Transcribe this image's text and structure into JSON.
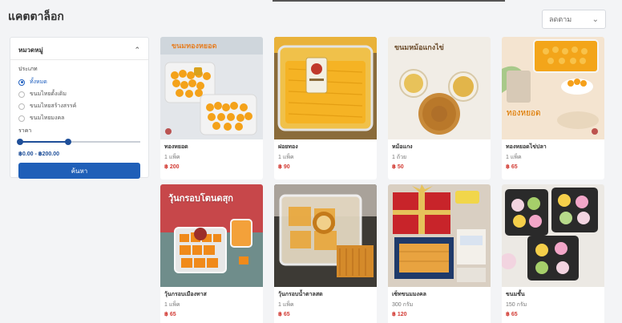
{
  "page": {
    "title": "แคตตาล็อก"
  },
  "sort": {
    "label": "ลดตาม"
  },
  "filter": {
    "heading": "หมวดหมู่",
    "category_label": "ประเภท",
    "options": [
      "ทั้งหมด",
      "ขนมไทยดั้งเดิม",
      "ขนมไทยสร้างสรรค์",
      "ขนมไทยมงคล"
    ],
    "selected_index": 0,
    "price_label": "ราคา",
    "price_range": "฿0.00 - ฿200.00",
    "price_fill_fraction": 0.4,
    "search_button": "ค้นหา"
  },
  "products": [
    {
      "name": "ทองหยอด",
      "unit": "1 แพ็ค",
      "price": "฿ 200",
      "caption": "ขนมทองหยอด"
    },
    {
      "name": "ฝอยทอง",
      "unit": "1 แพ็ค",
      "price": "฿ 90",
      "caption": ""
    },
    {
      "name": "หม้อแกง",
      "unit": "1 ถ้วย",
      "price": "฿ 50",
      "caption": "ขนมหม้อแกงไข่"
    },
    {
      "name": "ทองหยอดไข่ปลา",
      "unit": "1 แพ็ค",
      "price": "฿ 65",
      "caption": "ทองหยอด"
    },
    {
      "name": "วุ้นกรอบเมืองทาส",
      "unit": "1 แพ็ค",
      "price": "฿ 65",
      "caption": "วุ้นกรอบโตนดสุก"
    },
    {
      "name": "วุ้นกรอบน้ำตาลสด",
      "unit": "1 แพ็ค",
      "price": "฿ 65",
      "caption": ""
    },
    {
      "name": "เซ็ทขนมมงคล",
      "unit": "300 กรัม",
      "price": "฿ 120",
      "caption": ""
    },
    {
      "name": "ขนมชั้น",
      "unit": "150 กรัม",
      "price": "฿ 65",
      "caption": ""
    }
  ]
}
